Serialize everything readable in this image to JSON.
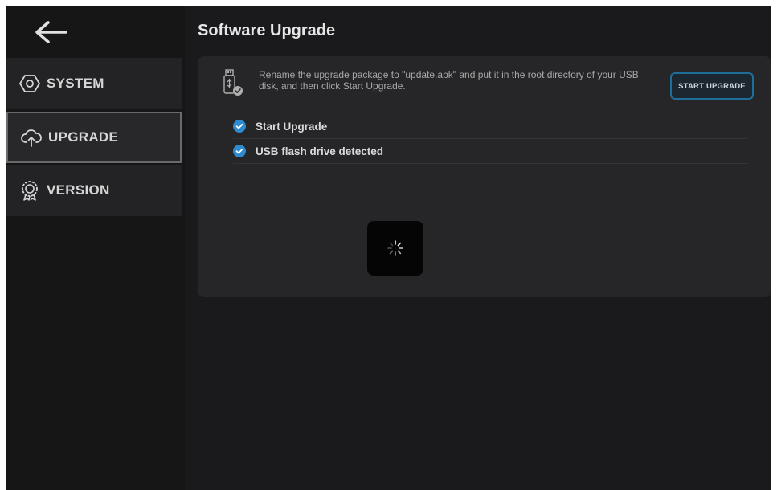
{
  "sidebar": {
    "items": [
      {
        "label": "SYSTEM",
        "icon": "system-icon"
      },
      {
        "label": "UPGRADE",
        "icon": "cloud-upload-icon"
      },
      {
        "label": "VERSION",
        "icon": "badge-icon"
      }
    ],
    "active_index": 1
  },
  "page": {
    "title": "Software Upgrade"
  },
  "upgrade_card": {
    "description": "Rename the upgrade package to \"update.apk\" and put it in the root directory of your USB disk, and then click Start Upgrade.",
    "start_button_label": "START UPGRADE",
    "steps": [
      {
        "label": "Start Upgrade",
        "status": "done"
      },
      {
        "label": "USB flash drive detected",
        "status": "done"
      }
    ]
  },
  "colors": {
    "accent": "#2e8bd0",
    "button_border": "#1f6e9a",
    "background": "#1a1a1c",
    "card": "#262628"
  },
  "loading": true
}
